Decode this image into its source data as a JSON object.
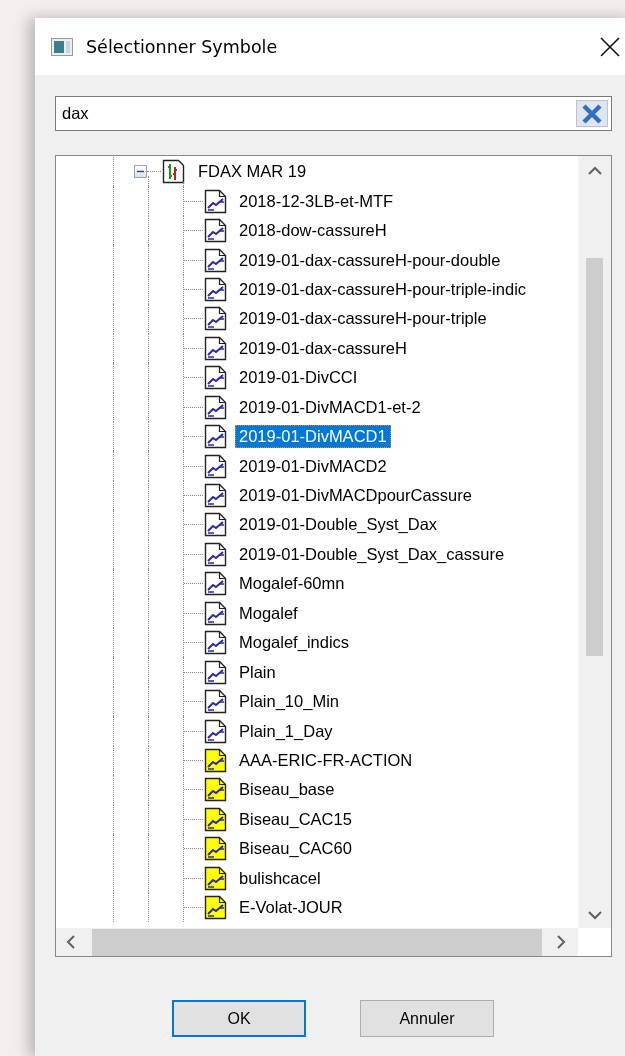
{
  "window": {
    "title": "Sélectionner Symbole"
  },
  "search": {
    "value": "dax"
  },
  "tree": {
    "items": [
      {
        "label": "FDAX MAR 19",
        "expanded": true,
        "selected": false,
        "children": [
          {
            "label": "2018-12-3LB-et-MTF",
            "kind": "standard",
            "selected": false
          },
          {
            "label": "2018-dow-cassureH",
            "kind": "standard",
            "selected": false
          },
          {
            "label": "2019-01-dax-cassureH-pour-double",
            "kind": "standard",
            "selected": false
          },
          {
            "label": "2019-01-dax-cassureH-pour-triple-indic",
            "kind": "standard",
            "selected": false
          },
          {
            "label": "2019-01-dax-cassureH-pour-triple",
            "kind": "standard",
            "selected": false
          },
          {
            "label": "2019-01-dax-cassureH",
            "kind": "standard",
            "selected": false
          },
          {
            "label": "2019-01-DivCCI",
            "kind": "standard",
            "selected": false
          },
          {
            "label": "2019-01-DivMACD1-et-2",
            "kind": "standard",
            "selected": false
          },
          {
            "label": "2019-01-DivMACD1",
            "kind": "standard",
            "selected": true
          },
          {
            "label": "2019-01-DivMACD2",
            "kind": "standard",
            "selected": false
          },
          {
            "label": "2019-01-DivMACDpourCassure",
            "kind": "standard",
            "selected": false
          },
          {
            "label": "2019-01-Double_Syst_Dax",
            "kind": "standard",
            "selected": false
          },
          {
            "label": "2019-01-Double_Syst_Dax_cassure",
            "kind": "standard",
            "selected": false
          },
          {
            "label": "Mogalef-60mn",
            "kind": "standard",
            "selected": false
          },
          {
            "label": "Mogalef",
            "kind": "standard",
            "selected": false
          },
          {
            "label": "Mogalef_indics",
            "kind": "standard",
            "selected": false
          },
          {
            "label": "Plain",
            "kind": "standard",
            "selected": false
          },
          {
            "label": "Plain_10_Min",
            "kind": "standard",
            "selected": false
          },
          {
            "label": "Plain_1_Day",
            "kind": "standard",
            "selected": false
          },
          {
            "label": "AAA-ERIC-FR-ACTION",
            "kind": "marked",
            "selected": false
          },
          {
            "label": "Biseau_base",
            "kind": "marked",
            "selected": false
          },
          {
            "label": "Biseau_CAC15",
            "kind": "marked",
            "selected": false
          },
          {
            "label": "Biseau_CAC60",
            "kind": "marked",
            "selected": false
          },
          {
            "label": "bulishcacel",
            "kind": "marked",
            "selected": false
          },
          {
            "label": "E-Volat-JOUR",
            "kind": "marked",
            "selected": false
          }
        ]
      }
    ]
  },
  "buttons": [
    {
      "label": "OK",
      "default": true
    },
    {
      "label": "Annuler",
      "default": false
    }
  ]
}
